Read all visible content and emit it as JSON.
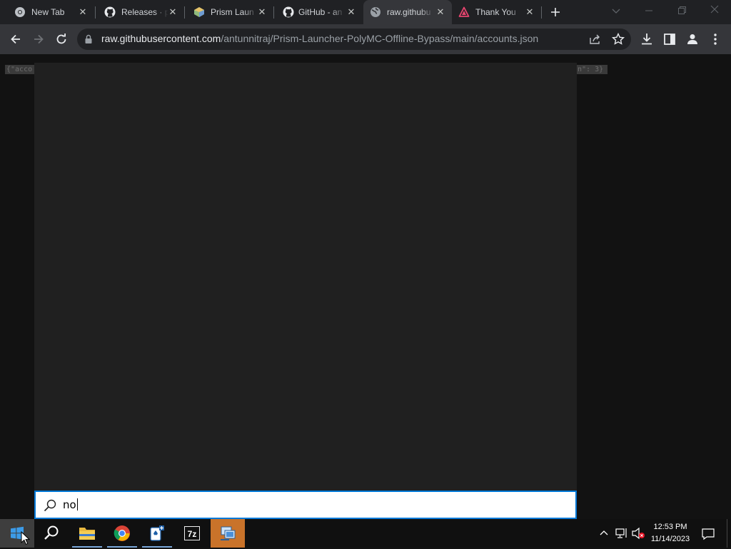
{
  "browser": {
    "tabs": [
      {
        "title": "New Tab",
        "icon": "chrome-icon"
      },
      {
        "title": "Releases · p",
        "icon": "github-icon"
      },
      {
        "title": "Prism Laun",
        "icon": "prism-icon"
      },
      {
        "title": "GitHub - an",
        "icon": "github-icon"
      },
      {
        "title": "raw.githubu",
        "icon": "globe-icon"
      },
      {
        "title": "Thank You",
        "icon": "thankyou-icon"
      }
    ],
    "url_host": "raw.githubusercontent.com",
    "url_path": "/antunnitraj/Prism-Launcher-PolyMC-Offline-Bypass/main/accounts.json"
  },
  "page": {
    "json_left": "{\"acco",
    "json_right": "n\": 3}"
  },
  "search": {
    "query": "no"
  },
  "taskbar": {
    "time": "12:53 PM",
    "date": "11/14/2023"
  },
  "colors": {
    "accent": "#0078d7",
    "active_app": "#c9732a"
  }
}
